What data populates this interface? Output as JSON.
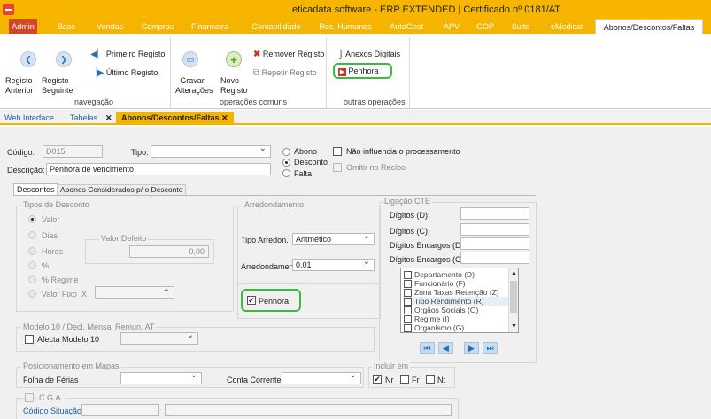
{
  "window": {
    "title": "eticadata software - ERP EXTENDED | Certificado nº 0181/AT"
  },
  "ribbon_tabs": [
    "Admin",
    "Base",
    "Vendas",
    "Compras",
    "Financeira",
    "Contabilidade",
    "Rec. Humanos",
    "AutoGest",
    "APV",
    "GOP",
    "Suite",
    "eMedical",
    "Abonos/Descontos/Faltas"
  ],
  "ribbon": {
    "nav": {
      "prev_l1": "Registo",
      "prev_l2": "Anterior",
      "next_l1": "Registo",
      "next_l2": "Seguinte",
      "first": "Primeiro Registo",
      "last": "Último Registo",
      "group": "navegação"
    },
    "common": {
      "save": "Gravar",
      "save_l2": "Alterações",
      "new_l1": "Novo",
      "new_l2": "Registo",
      "remove": "Remover Registo",
      "repeat": "Repetir Registo",
      "group": "operações comuns"
    },
    "other": {
      "annex": "Anexos Digitais",
      "penhora": "Penhora",
      "group": "outras operações"
    }
  },
  "doc_tabs": {
    "web": "Web Interface",
    "tabelas": "Tabelas",
    "active": "Abonos/Descontos/Faltas",
    "close": "✕"
  },
  "form": {
    "codigo_label": "Código:",
    "codigo_value": "D015",
    "tipo_label": "Tipo:",
    "tipo_value": "",
    "descricao_label": "Descrição:",
    "descricao_value": "Penhora de vencimento",
    "kind_options": [
      "Abono",
      "Desconto",
      "Falta"
    ],
    "kind_selected": "Desconto",
    "nao_influencia": "Não influencia o processamento",
    "omitir_recibo": "Omitir no Recibo"
  },
  "subtabs": [
    "Descontos",
    "Abonos Considerados p/ o Desconto"
  ],
  "tipos_desconto": {
    "title": "Tipos de Desconto",
    "options": [
      "Valor",
      "Dias",
      "Horas",
      "%",
      "% Regime",
      "Valor Fixo"
    ],
    "selected": "Valor",
    "x_label": "X",
    "valor_defeito_label": "Valor Defeito",
    "valor_defeito_value": "0,00"
  },
  "arredondamento": {
    "title": "Arredondamento",
    "tipo_label": "Tipo Arredon.",
    "tipo_value": "Aritmético",
    "arred_label": "Arredondamento",
    "arred_value": "0.01",
    "penhora_label": "Penhora",
    "penhora_checked": true
  },
  "ligacao_cte": {
    "title": "Ligação CTE",
    "fields": [
      "Dígitos (D):",
      "Dígitos (C):",
      "Dígitos Encargos (D):",
      "Dígitos Encargos (C):"
    ],
    "list_items": [
      "Departamento (D)",
      "Funcionário (F)",
      "Zona Taxas Retenção (Z)",
      "Tipo Rendimento (R)",
      "Orgãos Sociais (O)",
      "Regime (I)",
      "Organismo (G)"
    ],
    "nav": [
      "⏮",
      "◀",
      "▶",
      "⏭"
    ]
  },
  "modelo10": {
    "title": "Modelo 10 / Decl. Mensal Remun. AT",
    "afecta_label": "Afecta Modelo 10"
  },
  "mapas": {
    "title": "Posicionamento em Mapas",
    "folha_label": "Folha de Férias",
    "conta_label": "Conta Corrente"
  },
  "incluir": {
    "title": "Incluir em",
    "options": [
      "Nr",
      "Fr",
      "Nt"
    ],
    "checked": [
      "Nr"
    ]
  },
  "cga": {
    "title": "C.G.A.",
    "codigo_label": "Código Situação:"
  },
  "colors": {
    "accent": "#f5b400",
    "admin": "#d24726",
    "highlight": "#3cba3c"
  }
}
